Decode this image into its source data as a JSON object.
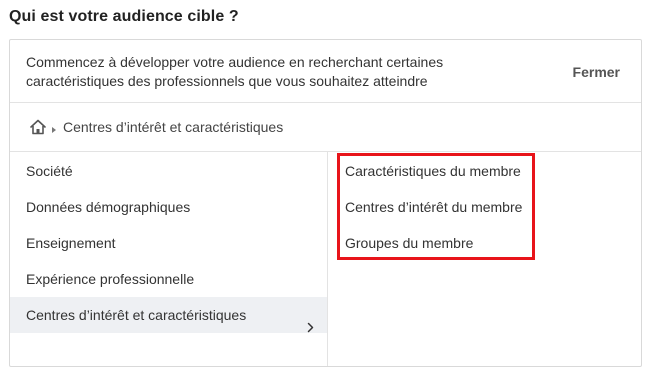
{
  "page": {
    "title": "Qui est votre audience cible ?"
  },
  "panel": {
    "intro_line1": "Commencez à développer votre audience en recherchant certaines",
    "intro_line2": "caractéristiques des professionnels que vous souhaitez atteindre",
    "close_label": "Fermer"
  },
  "breadcrumb": {
    "home_icon": "home-icon",
    "separator_icon": "triangle-right-icon",
    "current": "Centres d’intérêt et caractéristiques"
  },
  "categories": [
    {
      "label": "Société"
    },
    {
      "label": "Données démographiques"
    },
    {
      "label": "Enseignement"
    },
    {
      "label": "Expérience professionnelle"
    },
    {
      "label": "Centres d’intérêt et caractéristiques",
      "selected": true,
      "icon": "chevron-right-icon"
    }
  ],
  "subcategories": [
    {
      "label": "Caractéristiques du membre"
    },
    {
      "label": "Centres d’intérêt du membre"
    },
    {
      "label": "Groupes du membre"
    }
  ],
  "colors": {
    "highlight_border": "#e8141a",
    "selected_row_bg": "#eef0f3",
    "divider": "#e3e3e3"
  }
}
